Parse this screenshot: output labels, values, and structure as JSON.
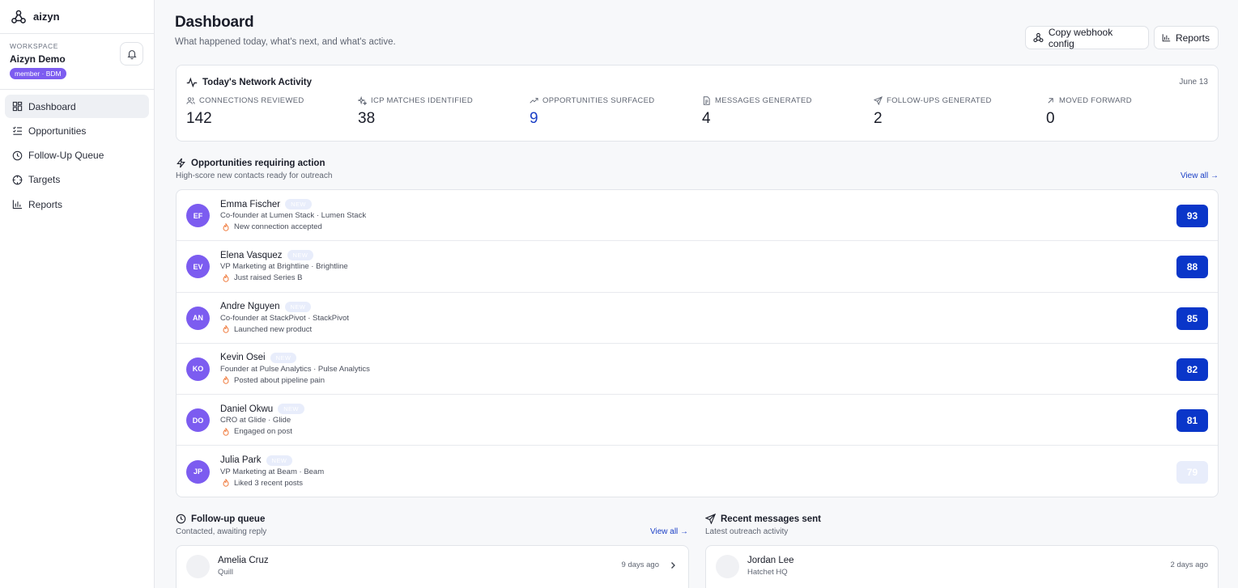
{
  "brand": {
    "name": "aizyn"
  },
  "workspace": {
    "caption": "WORKSPACE",
    "name": "Aizyn Demo",
    "badge": "member · BDM"
  },
  "nav": {
    "items": [
      {
        "label": "Dashboard",
        "icon": "dashboard-icon",
        "active": true
      },
      {
        "label": "Opportunities",
        "icon": "checklist-icon"
      },
      {
        "label": "Follow-Up Queue",
        "icon": "clock-icon"
      },
      {
        "label": "Targets",
        "icon": "crosshair-icon"
      },
      {
        "label": "Reports",
        "icon": "bar-chart-icon"
      }
    ]
  },
  "header": {
    "title": "Dashboard",
    "subtitle": "What happened today, what's next, and what's active.",
    "webhook_label": "Copy webhook config",
    "reports_label": "Reports"
  },
  "activity": {
    "title": "Today's Network Activity",
    "date": "June 13",
    "stats": [
      {
        "label": "CONNECTIONS REVIEWED",
        "value": "142"
      },
      {
        "label": "ICP MATCHES IDENTIFIED",
        "value": "38"
      },
      {
        "label": "OPPORTUNITIES SURFACED",
        "value": "9"
      },
      {
        "label": "MESSAGES GENERATED",
        "value": "4"
      },
      {
        "label": "FOLLOW-UPS GENERATED",
        "value": "2"
      },
      {
        "label": "MOVED FORWARD",
        "value": "0"
      }
    ]
  },
  "opportunities": {
    "title": "Opportunities requiring action",
    "subtitle": "High-score new contacts ready for outreach",
    "view_all": "View all →",
    "new_badge": "NEW",
    "rows": [
      {
        "initials": "EF",
        "name": "Emma Fischer",
        "role": "Co-founder at Lumen Stack · Lumen Stack",
        "signal": "New connection accepted",
        "score": "93"
      },
      {
        "initials": "EV",
        "name": "Elena Vasquez",
        "role": "VP Marketing at Brightline · Brightline",
        "signal": "Just raised Series B",
        "score": "88"
      },
      {
        "initials": "AN",
        "name": "Andre Nguyen",
        "role": "Co-founder at StackPivot · StackPivot",
        "signal": "Launched new product",
        "score": "85"
      },
      {
        "initials": "KO",
        "name": "Kevin Osei",
        "role": "Founder at Pulse Analytics · Pulse Analytics",
        "signal": "Posted about pipeline pain",
        "score": "82"
      },
      {
        "initials": "DO",
        "name": "Daniel Okwu",
        "role": "CRO at Glide · Glide",
        "signal": "Engaged on post",
        "score": "81"
      },
      {
        "initials": "JP",
        "name": "Julia Park",
        "role": "VP Marketing at Beam · Beam",
        "signal": "Liked 3 recent posts",
        "score": "79"
      }
    ]
  },
  "followup": {
    "title": "Follow-up queue",
    "subtitle": "Contacted, awaiting reply",
    "view_all": "View all →",
    "items": [
      {
        "name": "Amelia Cruz",
        "company": "Quill",
        "time": "9 days ago"
      }
    ]
  },
  "messages": {
    "title": "Recent messages sent",
    "subtitle": "Latest outreach activity",
    "items": [
      {
        "name": "Jordan Lee",
        "company": "Hatchet HQ",
        "time": "2 days ago"
      }
    ]
  },
  "colors": {
    "accent": "#0a36c9",
    "avatar": "#7c5cf0",
    "signal": "#f07a3c"
  }
}
